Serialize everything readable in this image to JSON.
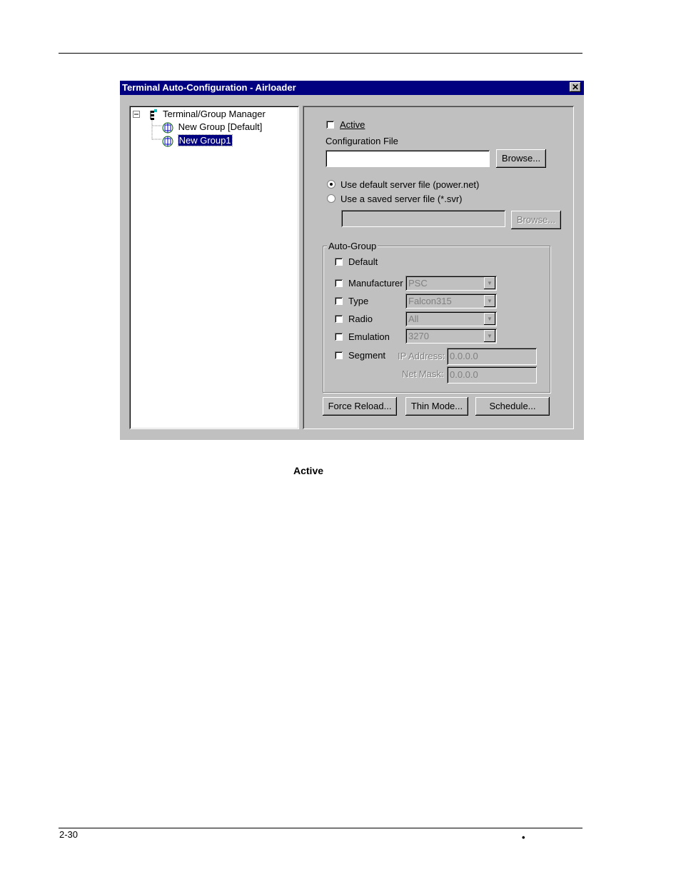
{
  "window": {
    "title": "Terminal Auto-Configuration - Airloader",
    "close_label": "✕"
  },
  "tree": {
    "root": "Terminal/Group Manager",
    "items": [
      "New Group [Default]",
      "New Group1"
    ]
  },
  "panel": {
    "active_label": "Active",
    "config_file_label": "Configuration File",
    "config_file_value": "",
    "browse_label": "Browse...",
    "radio_default": "Use default server file (power.net)",
    "radio_saved": "Use a saved server file (*.svr)",
    "saved_value": "",
    "browse2_label": "Browse..."
  },
  "auto_group": {
    "title": "Auto-Group",
    "default_label": "Default",
    "manufacturer_label": "Manufacturer",
    "manufacturer_value": "PSC",
    "type_label": "Type",
    "type_value": "Falcon315",
    "radio_label": "Radio",
    "radio_value": "All",
    "emulation_label": "Emulation",
    "emulation_value": "3270",
    "segment_label": "Segment",
    "ip_label": "IP Address:",
    "ip_value": "0.0.0.0",
    "netmask_label": "Net Mask:",
    "netmask_value": "0.0.0.0"
  },
  "buttons": {
    "force_reload": "Force Reload...",
    "thin_mode": "Thin Mode...",
    "schedule": "Schedule..."
  },
  "caption": "Active",
  "footer": {
    "page_number": "2-30",
    "bullet": "•"
  }
}
